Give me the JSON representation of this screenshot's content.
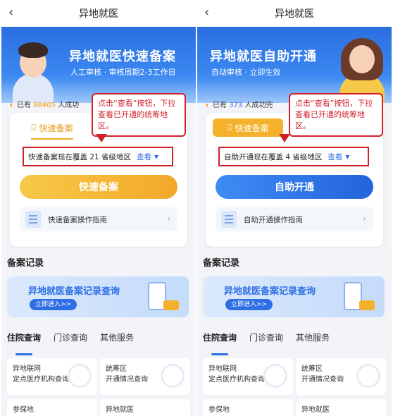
{
  "screens": [
    {
      "nav": {
        "back_icon": "chevron-left-icon",
        "title": "异地就医"
      },
      "banner": {
        "title": "异地就医快速备案",
        "subtitle": "人工审核 · 审核周期2-3工作日"
      },
      "notice": {
        "prefix": "已有",
        "count": "98405",
        "suffix": "人成功"
      },
      "card": {
        "tab_label": "快速备案",
        "coverage_text": "快速备案现在覆盖 21 省级地区",
        "view_label": "查看",
        "main_button": "快速备案",
        "guide_label": "快速备案操作指南"
      },
      "callout": "点击“查看”按钮，下拉查看已开通的统筹地区。"
    },
    {
      "nav": {
        "back_icon": "chevron-left-icon",
        "title": "异地就医"
      },
      "banner": {
        "title": "异地就医自助开通",
        "subtitle": "自动审核 · 立即生效"
      },
      "notice": {
        "prefix": "已有",
        "count": "373",
        "suffix": "人成功完"
      },
      "card": {
        "tab_label": "快速备案",
        "coverage_text": "自助开通现在覆盖 4 省级地区",
        "view_label": "查看",
        "main_button": "自助开通",
        "guide_label": "自助开通操作指南"
      },
      "callout": "点击“查看”按钮，下拉查看已开通的统筹地区。"
    }
  ],
  "records": {
    "section_title": "备案记录",
    "banner_title": "异地就医备案记录查询",
    "enter_button": "立即进入>>"
  },
  "tabs": [
    "住院查询",
    "门诊查询",
    "其他服务"
  ],
  "services": [
    {
      "line1": "异地联网",
      "line2": "定点医疗机构查询"
    },
    {
      "line1": "统筹区",
      "line2": "开通情况查询"
    },
    {
      "line1": "参保地",
      "line2": ""
    },
    {
      "line1": "异地就医",
      "line2": ""
    }
  ],
  "colors": {
    "accent_blue": "#2e6fe6",
    "accent_yellow": "#f5b12b",
    "highlight_red": "#d0202a"
  }
}
